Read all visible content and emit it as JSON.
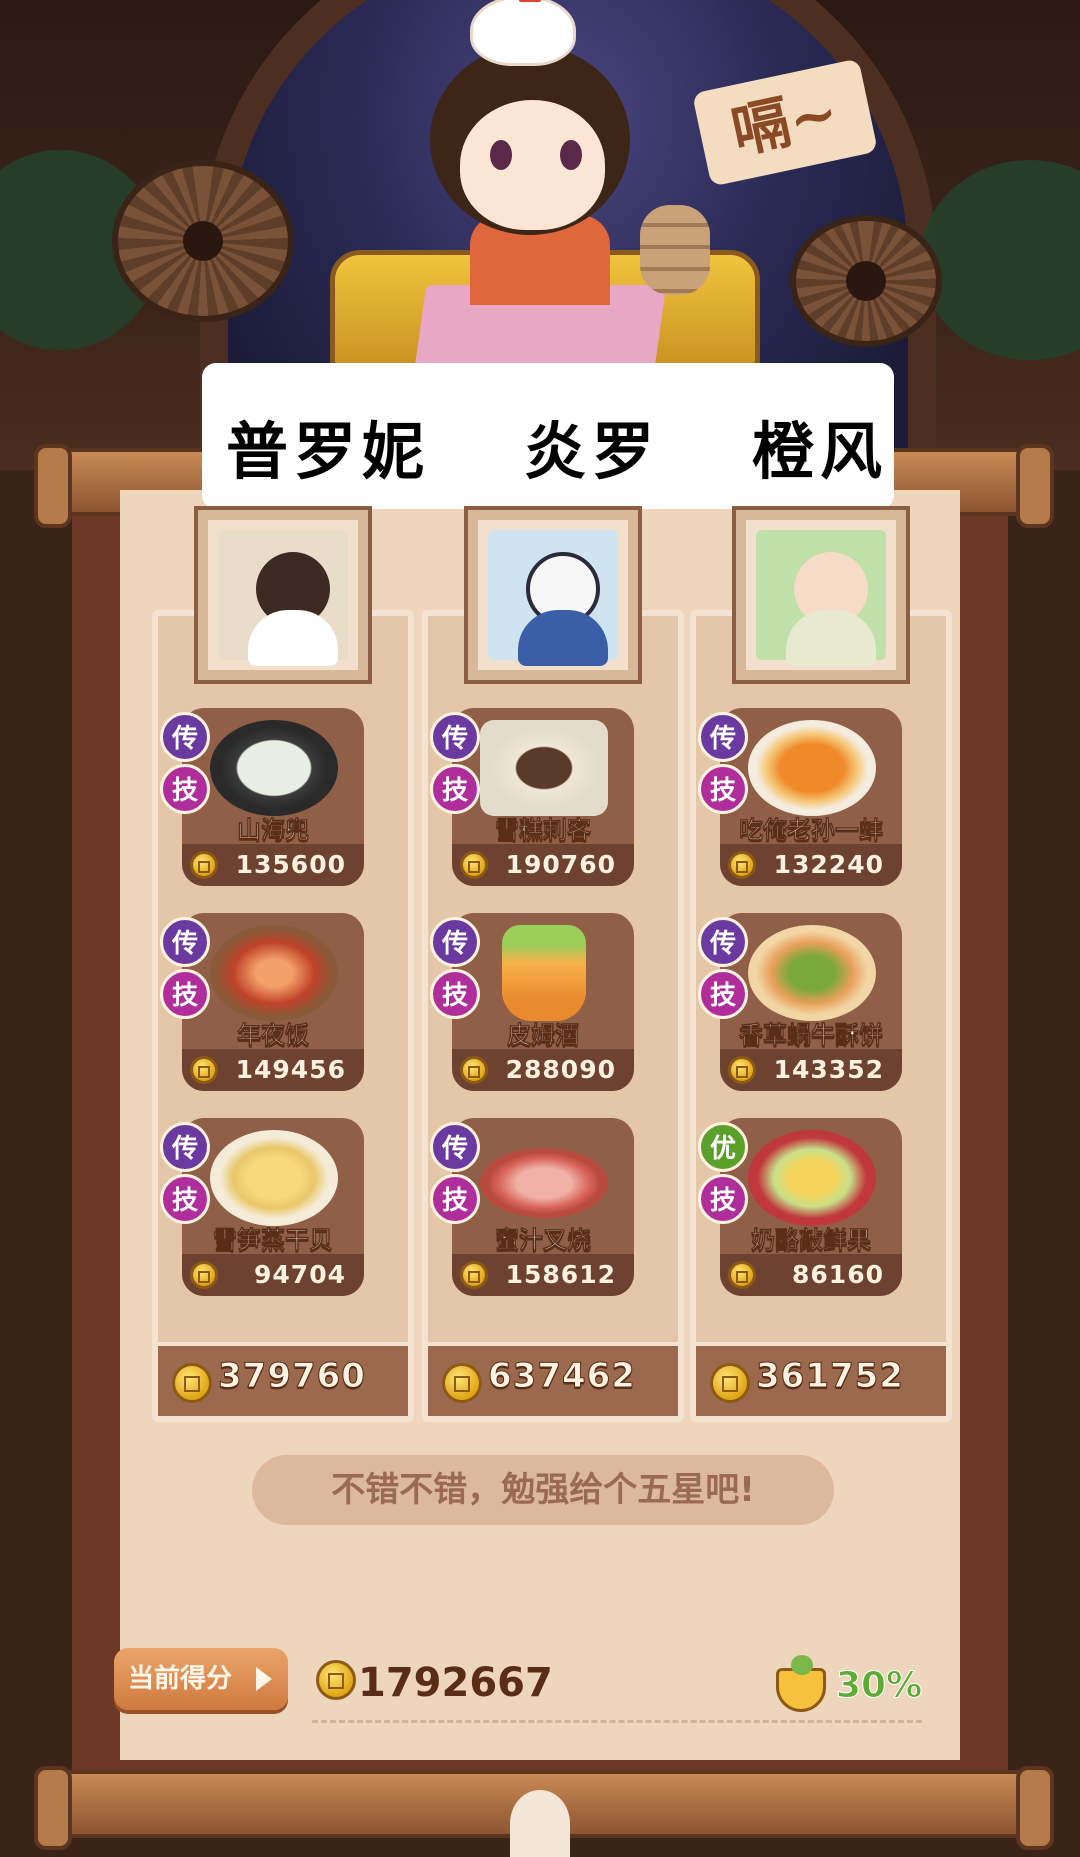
{
  "header": {
    "sign_text": "嗝~",
    "chef_names": [
      "普罗妮",
      "炎罗",
      "橙风"
    ]
  },
  "columns": [
    {
      "chef": "普罗妮",
      "portrait_icon": "chef-pronie-portrait",
      "dishes": [
        {
          "name": "山海兜",
          "price": "135600",
          "badges": [
            "传",
            "技"
          ],
          "icon": "dumpling-pan-icon"
        },
        {
          "name": "年夜饭",
          "price": "149456",
          "badges": [
            "传",
            "技"
          ],
          "icon": "new-year-feast-icon"
        },
        {
          "name": "雪笋蒸干贝",
          "price": "94704",
          "badges": [
            "传",
            "技"
          ],
          "icon": "steamed-scallop-icon"
        }
      ],
      "total": "379760"
    },
    {
      "chef": "炎罗",
      "portrait_icon": "chef-yanluo-portrait",
      "dishes": [
        {
          "name": "雪糕刺客",
          "price": "190760",
          "badges": [
            "传",
            "技"
          ],
          "icon": "ice-cream-assassin-icon"
        },
        {
          "name": "皮姆酒",
          "price": "288090",
          "badges": [
            "传",
            "技"
          ],
          "icon": "pimms-drink-icon"
        },
        {
          "name": "蜜汁叉烧",
          "price": "158612",
          "badges": [
            "传",
            "技"
          ],
          "icon": "char-siu-icon"
        }
      ],
      "total": "637462"
    },
    {
      "chef": "橙风",
      "portrait_icon": "chef-chengfeng-portrait",
      "dishes": [
        {
          "name": "吃俺老孙一蚌",
          "price": "132240",
          "badges": [
            "传",
            "技"
          ],
          "icon": "clam-plate-icon"
        },
        {
          "name": "香草蜗牛酥饼",
          "price": "143352",
          "badges": [
            "传",
            "技"
          ],
          "icon": "snail-pastry-icon"
        },
        {
          "name": "奶酪敲鲜果",
          "price": "86160",
          "badges": [
            "优",
            "技"
          ],
          "icon": "cheese-fruit-icon"
        }
      ],
      "total": "361752"
    }
  ],
  "comment": "不错不错，勉强给个五星吧!",
  "score": {
    "label": "当前得分",
    "value": "1792667",
    "bonus_percent": "30%"
  },
  "colors": {
    "legend_badge": "#6a3aa0",
    "skill_badge": "#b02e9c",
    "good_badge": "#5aa02a",
    "percent_green": "#5cab35"
  }
}
